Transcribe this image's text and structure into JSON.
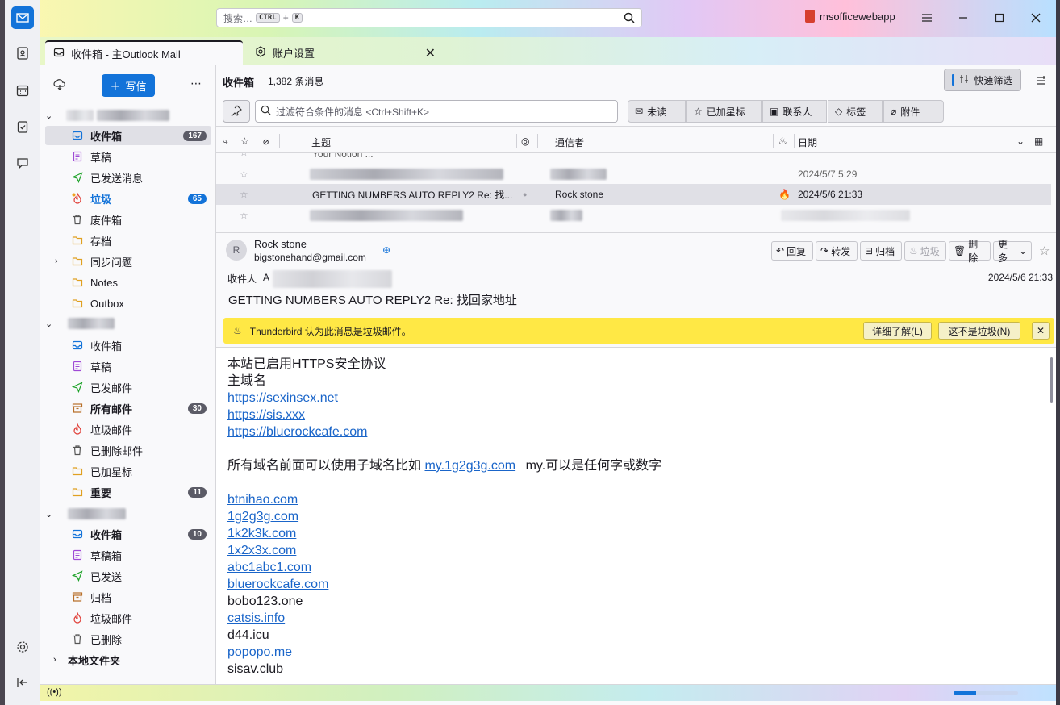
{
  "titlebar": {
    "search_placeholder": "搜索…",
    "search_key_ctrl": "CTRL",
    "search_key_plus": "+",
    "search_key_k": "K",
    "brand": "msofficewebapp"
  },
  "tabs": [
    {
      "label": "收件箱 - 主Outlook Mail"
    },
    {
      "label": "账户设置"
    }
  ],
  "toolbar": {
    "write_label": "写信"
  },
  "accounts": [
    {
      "folders": [
        {
          "label": "收件箱",
          "count": "167"
        },
        {
          "label": "草稿"
        },
        {
          "label": "已发送消息"
        },
        {
          "label": "垃圾",
          "count": "65"
        },
        {
          "label": "废件箱"
        },
        {
          "label": "存档"
        },
        {
          "label": "同步问题"
        },
        {
          "label": "Notes"
        },
        {
          "label": "Outbox"
        }
      ]
    },
    {
      "folders": [
        {
          "label": "收件箱"
        },
        {
          "label": "草稿"
        },
        {
          "label": "已发邮件"
        },
        {
          "label": "所有邮件",
          "count": "30"
        },
        {
          "label": "垃圾邮件"
        },
        {
          "label": "已删除邮件"
        },
        {
          "label": "已加星标"
        },
        {
          "label": "重要",
          "count": "11"
        }
      ]
    },
    {
      "folders": [
        {
          "label": "收件箱",
          "count": "10"
        },
        {
          "label": "草稿箱"
        },
        {
          "label": "已发送"
        },
        {
          "label": "归档"
        },
        {
          "label": "垃圾邮件"
        },
        {
          "label": "已删除"
        }
      ]
    }
  ],
  "local_folders": "本地文件夹",
  "list": {
    "folder_name": "收件箱",
    "message_count": "1,382 条消息",
    "quick_filter": "快速筛选",
    "filter_placeholder": "过滤符合条件的消息 <Ctrl+Shift+K>",
    "chips": [
      "未读",
      "已加星标",
      "联系人",
      "标签",
      "附件"
    ],
    "columns": {
      "subject": "主题",
      "correspondent": "通信者",
      "date": "日期"
    },
    "rows": [
      {
        "subject": "Your Notion ...",
        "correspondent": "",
        "date": ""
      },
      {
        "subject": "",
        "correspondent": "",
        "date": "2024/5/7 5:29"
      },
      {
        "subject": "GETTING NUMBERS AUTO REPLY2 Re: 找...",
        "correspondent": "Rock stone",
        "date": "2024/5/6 21:33"
      },
      {
        "subject": "",
        "correspondent": "",
        "date": ""
      }
    ]
  },
  "message": {
    "sender_name": "Rock stone",
    "sender_email": "bigstonehand@gmail.com",
    "recipient_label": "收件人",
    "recipient_initial": "A",
    "date": "2024/5/6 21:33",
    "subject": "GETTING NUMBERS AUTO REPLY2 Re: 找回家地址",
    "actions": {
      "reply": "回复",
      "forward": "转发",
      "archive": "归档",
      "junk": "垃圾",
      "delete": "删除",
      "more": "更多"
    }
  },
  "spam_notice": {
    "text": "Thunderbird 认为此消息是垃圾邮件。",
    "learn_more": "详细了解(L)",
    "not_junk": "这不是垃圾(N)"
  },
  "body": {
    "line1": "本站已启用HTTPS安全协议",
    "line2": "主域名",
    "link1": "https://sexinsex.net",
    "link2": "https://sis.xxx",
    "link3": "https://bluerockcafe.com",
    "subdomain_text": "所有域名前面可以使用子域名比如",
    "subdomain_link": "my.1g2g3g.com",
    "subdomain_tail": "my.可以是任何字或数字",
    "domains": [
      {
        "text": "btnihao.com",
        "link": true
      },
      {
        "text": "1g2g3g.com",
        "link": true
      },
      {
        "text": "1k2k3k.com",
        "link": true
      },
      {
        "text": "1x2x3x.com",
        "link": true
      },
      {
        "text": "abc1abc1.com",
        "link": true
      },
      {
        "text": "bluerockcafe.com",
        "link": true
      },
      {
        "text": "bobo123.one",
        "link": false
      },
      {
        "text": "catsis.info",
        "link": true
      },
      {
        "text": "d44.icu",
        "link": false
      },
      {
        "text": "popopo.me",
        "link": true
      },
      {
        "text": "sisav.club",
        "link": false
      }
    ]
  },
  "status": {
    "progress": 0.35
  },
  "colors": {
    "accent": "#1373d9",
    "spam_bar": "#ffe845",
    "link": "#1a65c9"
  }
}
